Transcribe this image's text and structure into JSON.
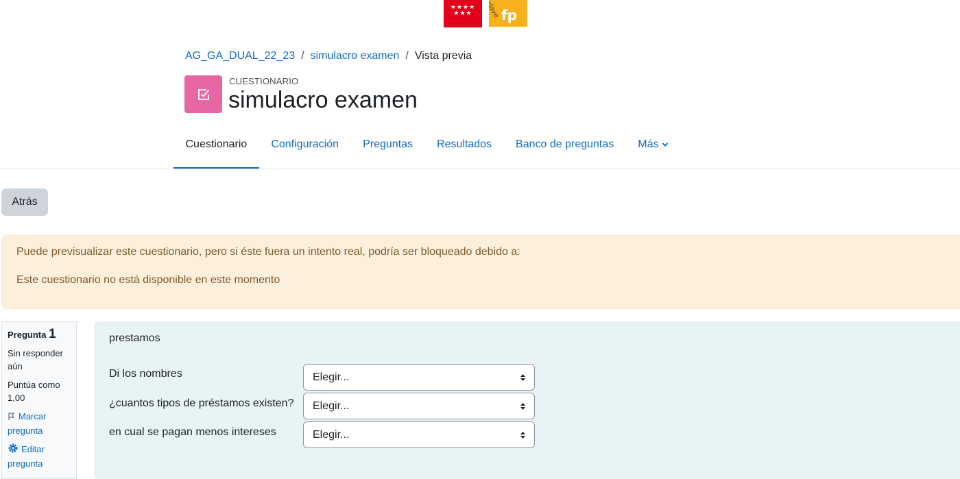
{
  "logos": {
    "madrid_stars": "★★★★ ★★★",
    "fp_text": "fp",
    "fp_arc_text": "clave"
  },
  "breadcrumb": {
    "items": [
      "AG_GA_DUAL_22_23",
      "simulacro examen",
      "Vista previa"
    ],
    "separator": "/"
  },
  "header": {
    "pretitle": "CUESTIONARIO",
    "title": "simulacro examen",
    "icon_color": "#e767a5"
  },
  "tabs": [
    {
      "label": "Cuestionario",
      "active": true
    },
    {
      "label": "Configuración",
      "active": false
    },
    {
      "label": "Preguntas",
      "active": false
    },
    {
      "label": "Resultados",
      "active": false
    },
    {
      "label": "Banco de preguntas",
      "active": false
    },
    {
      "label": "Más",
      "active": false
    }
  ],
  "back_button": "Atrás",
  "alert": {
    "line1": "Puede previsualizar este cuestionario, pero si éste fuera un intento real, podría ser bloqueado debido a:",
    "line2": "Este cuestionario no está disponible en este momento"
  },
  "question_info": {
    "label": "Pregunta",
    "number": "1",
    "state": "Sin responder aún",
    "grade": "Puntúa como 1,00",
    "flag_link": "Marcar pregunta",
    "edit_link": "Editar pregunta"
  },
  "question": {
    "text": "prestamos",
    "rows": [
      {
        "prompt": "Di los nombres",
        "selected": "Elegir..."
      },
      {
        "prompt": "¿cuantos tipos de préstamos existen?",
        "selected": "Elegir..."
      },
      {
        "prompt": "en cual se pagan menos intereses",
        "selected": "Elegir..."
      }
    ]
  },
  "colors": {
    "link": "#0f6cbf",
    "alert_bg": "#fcefdc",
    "question_bg": "#e7f3f5"
  }
}
